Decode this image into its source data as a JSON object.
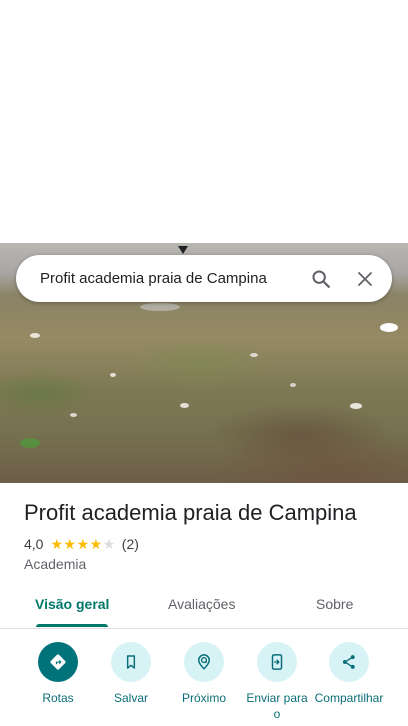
{
  "search": {
    "query": "Profit academia praia de Campina"
  },
  "place": {
    "title": "Profit academia praia de Campina",
    "rating": "4,0",
    "rating_value": 4,
    "rating_max": 5,
    "review_count": "(2)",
    "category": "Academia"
  },
  "tabs": [
    {
      "label": "Visão geral",
      "active": true
    },
    {
      "label": "Avaliações",
      "active": false
    },
    {
      "label": "Sobre",
      "active": false
    }
  ],
  "actions": [
    {
      "label": "Rotas",
      "icon": "directions-icon"
    },
    {
      "label": "Salvar",
      "icon": "bookmark-icon"
    },
    {
      "label": "Próximo",
      "icon": "nearby-icon"
    },
    {
      "label": "Enviar para o",
      "icon": "send-to-phone-icon"
    },
    {
      "label": "Compartilhar",
      "icon": "share-icon"
    }
  ],
  "colors": {
    "accent": "#00796b",
    "action_bg": "#d7f3f5",
    "primary_action_bg": "#00727a",
    "star": "#fbbc04"
  }
}
